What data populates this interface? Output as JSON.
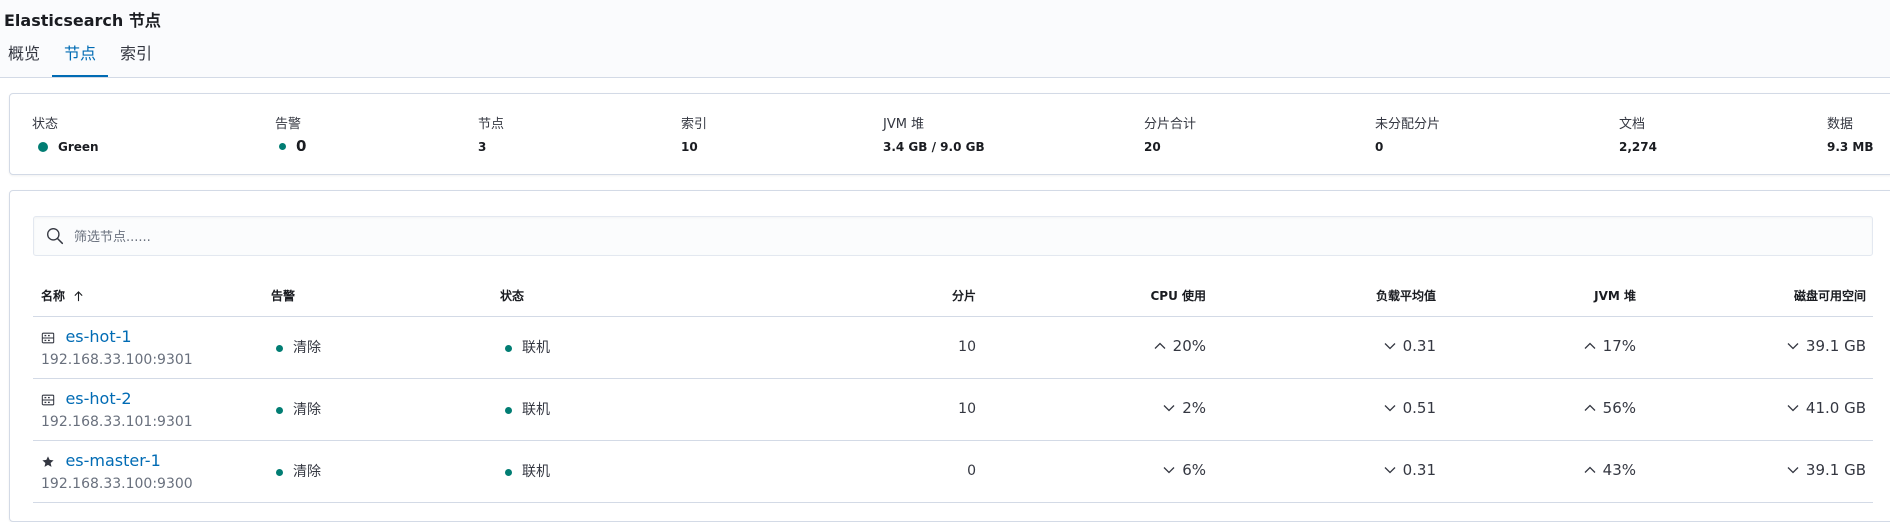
{
  "header": {
    "title": "Elasticsearch 节点",
    "tabs": [
      {
        "label": "概览",
        "active": false
      },
      {
        "label": "节点",
        "active": true
      },
      {
        "label": "索引",
        "active": false
      }
    ]
  },
  "summary": {
    "status": {
      "label": "状态",
      "value": "Green",
      "color": "#017d73"
    },
    "alerts": {
      "label": "告警",
      "value": "0"
    },
    "nodes": {
      "label": "节点",
      "value": "3"
    },
    "indices": {
      "label": "索引",
      "value": "10"
    },
    "jvm_heap": {
      "label": "JVM 堆",
      "value": "3.4 GB / 9.0 GB"
    },
    "total_shards": {
      "label": "分片合计",
      "value": "20"
    },
    "unassigned_shards": {
      "label": "未分配分片",
      "value": "0"
    },
    "documents": {
      "label": "文档",
      "value": "2,274"
    },
    "data": {
      "label": "数据",
      "value": "9.3 MB"
    }
  },
  "search": {
    "placeholder": "筛选节点......",
    "value": "",
    "icon": "search-icon"
  },
  "table": {
    "columns": {
      "name": "名称",
      "alerts": "告警",
      "status": "状态",
      "shards": "分片",
      "cpu": "CPU 使用",
      "load": "负载平均值",
      "jvm": "JVM 堆",
      "disk": "磁盘可用空间"
    },
    "sort_indicator": "ascending",
    "rows": [
      {
        "icon": "server-icon",
        "name": "es-hot-1",
        "address": "192.168.33.100:9301",
        "alerts": "清除",
        "status": "联机",
        "shards": "10",
        "cpu": {
          "trend": "up",
          "value": "20%"
        },
        "load": {
          "trend": "down",
          "value": "0.31"
        },
        "jvm": {
          "trend": "up",
          "value": "17%"
        },
        "disk": {
          "trend": "down",
          "value": "39.1 GB"
        }
      },
      {
        "icon": "server-icon",
        "name": "es-hot-2",
        "address": "192.168.33.101:9301",
        "alerts": "清除",
        "status": "联机",
        "shards": "10",
        "cpu": {
          "trend": "down",
          "value": "2%"
        },
        "load": {
          "trend": "down",
          "value": "0.51"
        },
        "jvm": {
          "trend": "up",
          "value": "56%"
        },
        "disk": {
          "trend": "down",
          "value": "41.0 GB"
        }
      },
      {
        "icon": "star-icon",
        "name": "es-master-1",
        "address": "192.168.33.100:9300",
        "alerts": "清除",
        "status": "联机",
        "shards": "0",
        "cpu": {
          "trend": "down",
          "value": "6%"
        },
        "load": {
          "trend": "down",
          "value": "0.31"
        },
        "jvm": {
          "trend": "up",
          "value": "43%"
        },
        "disk": {
          "trend": "down",
          "value": "39.1 GB"
        }
      }
    ]
  },
  "colors": {
    "accent": "#006bb4",
    "success": "#017d73"
  }
}
